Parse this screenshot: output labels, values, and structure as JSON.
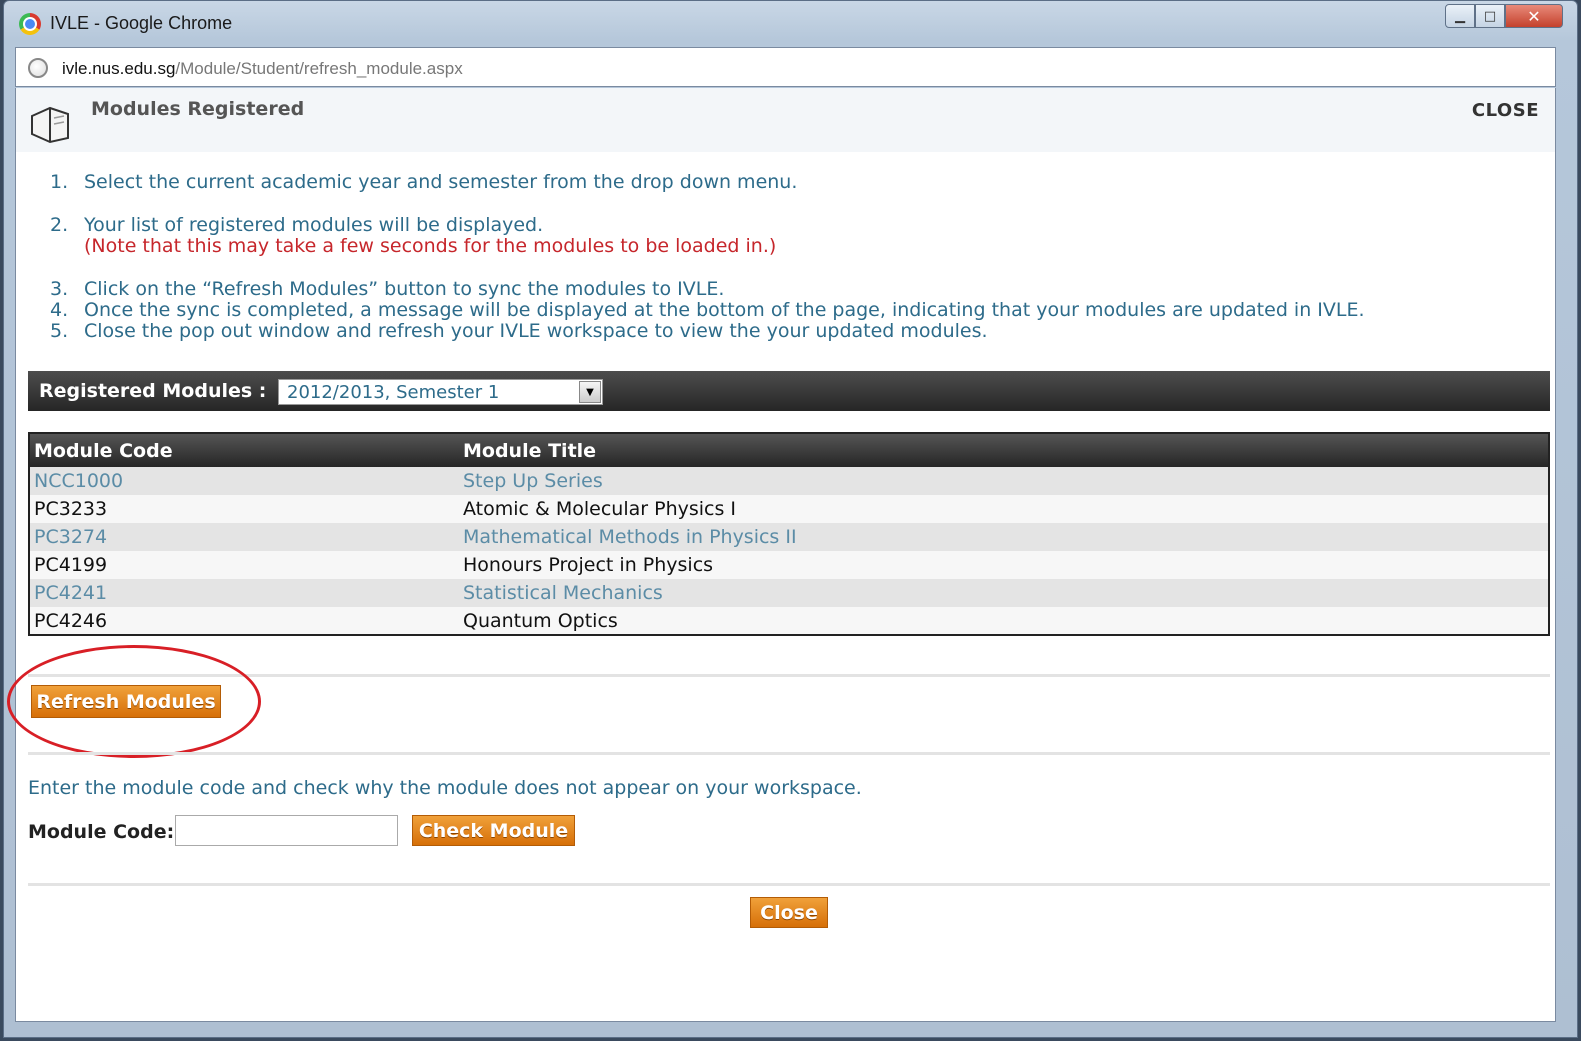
{
  "window": {
    "title": "IVLE - Google Chrome",
    "url_host": "ivle.nus.edu.sg",
    "url_path": "/Module/Student/refresh_module.aspx",
    "buttons": [
      "minimize",
      "maximize",
      "close"
    ]
  },
  "header": {
    "title": "Modules Registered",
    "close_label": "CLOSE",
    "icon": "book-icon"
  },
  "instructions": {
    "steps": [
      {
        "num": "1.",
        "text": "Select the current academic year and semester from the drop down menu."
      },
      {
        "num": "2.",
        "text": "Your list of registered modules will be displayed."
      },
      {
        "num": "3.",
        "text": "Click on the “Refresh Modules” button to sync the modules to IVLE."
      },
      {
        "num": "4.",
        "text": "Once the sync is completed, a message will be displayed at the bottom of the page, indicating that your modules are updated in IVLE."
      },
      {
        "num": "5.",
        "text": "Close the pop out window and refresh your IVLE workspace to view the your updated modules."
      }
    ],
    "note": "(Note that this may take a few seconds for the modules to be loaded in.)"
  },
  "registered": {
    "label": "Registered Modules :",
    "selected": "2012/2013, Semester 1"
  },
  "table": {
    "headers": [
      "Module Code",
      "Module Title"
    ],
    "rows": [
      [
        "NCC1000",
        "Step Up Series"
      ],
      [
        "PC3233",
        "Atomic & Molecular Physics I"
      ],
      [
        "PC3274",
        "Mathematical Methods in Physics II"
      ],
      [
        "PC4199",
        "Honours Project in Physics"
      ],
      [
        "PC4241",
        "Statistical Mechanics"
      ],
      [
        "PC4246",
        "Quantum Optics"
      ]
    ]
  },
  "refresh_button": "Refresh Modules",
  "check": {
    "instruction": "Enter the module code and check why the module does not appear on your workspace.",
    "label": "Module Code:",
    "input_value": "",
    "button": "Check Module"
  },
  "close_button": "Close",
  "colors": {
    "accent_orange": "#e0800f",
    "text_blue": "#2d6b8a",
    "note_red": "#c6262b",
    "highlight_red": "#d81f26"
  }
}
